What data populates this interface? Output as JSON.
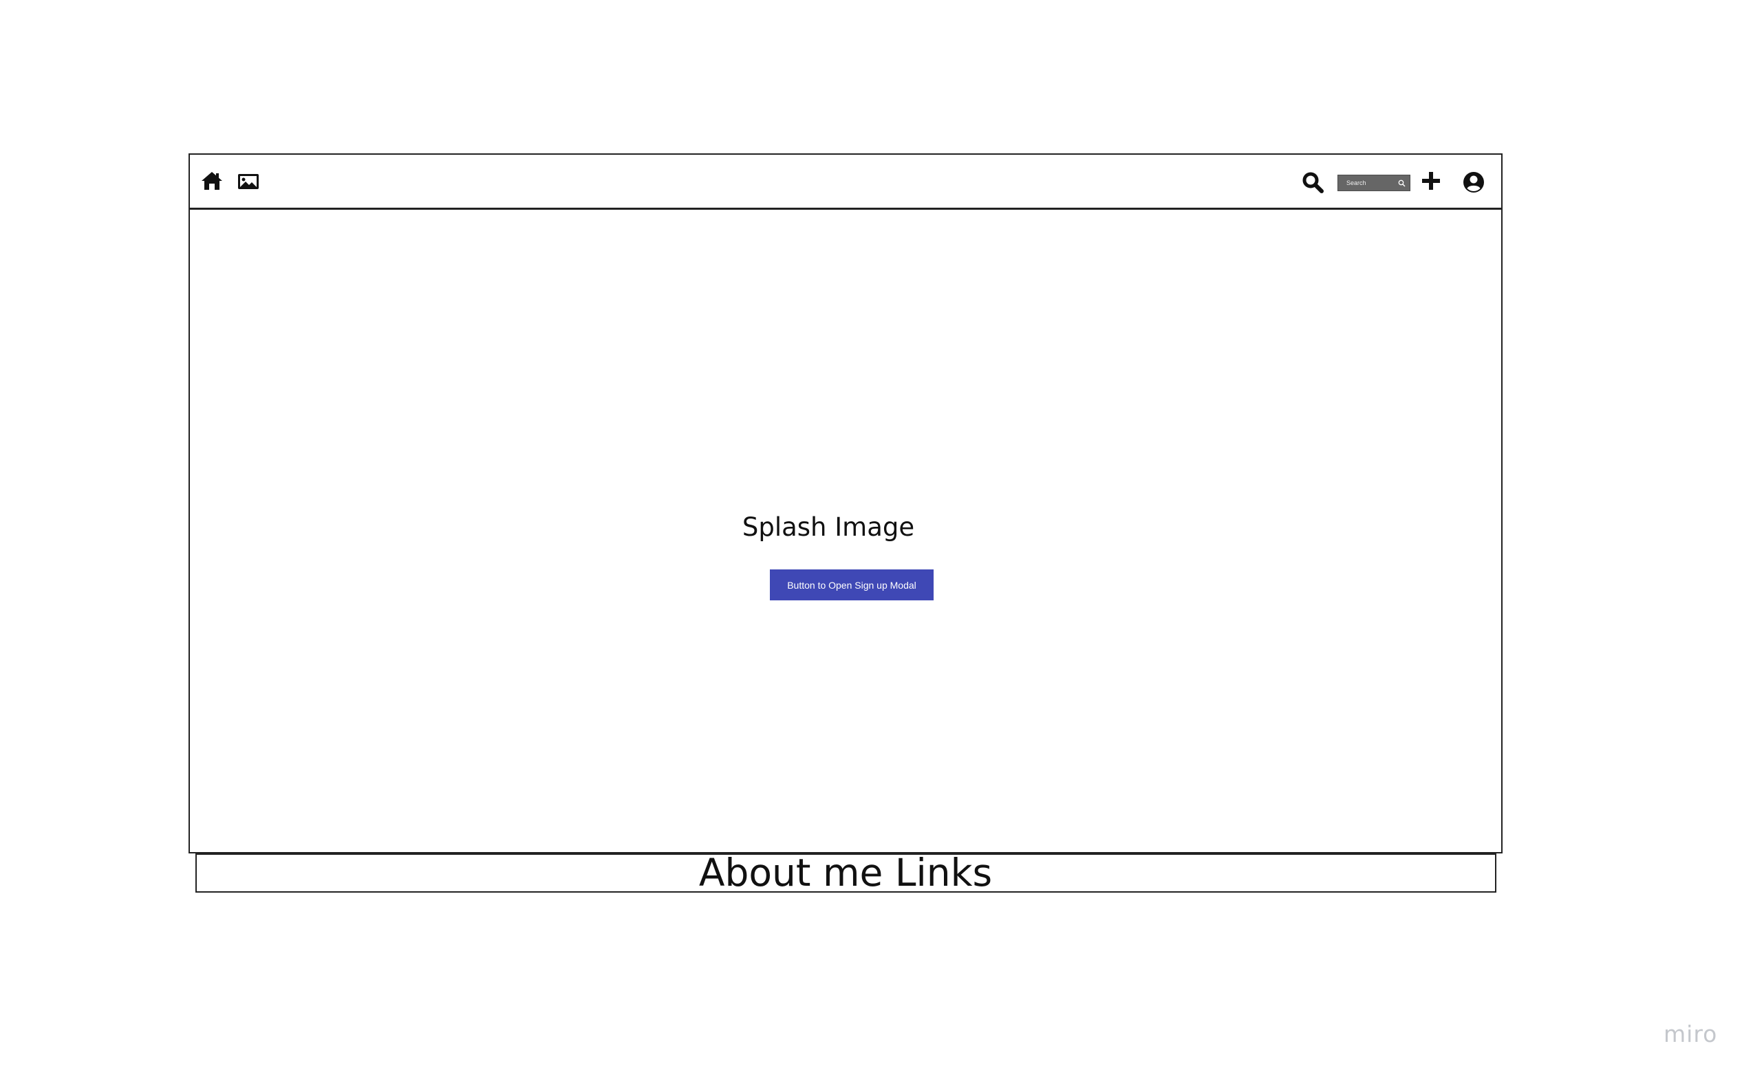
{
  "navbar": {
    "left_icons": [
      "home-icon",
      "image-icon"
    ],
    "right_icons": [
      "search-icon",
      "plus-icon",
      "account-circle-icon"
    ],
    "search": {
      "placeholder": "Search",
      "value": ""
    }
  },
  "main": {
    "splash_title": "Splash Image",
    "signup_button_label": "Button to Open Sign up Modal"
  },
  "footer": {
    "about_title": "About me Links"
  },
  "watermark": {
    "text": "miro"
  },
  "colors": {
    "primary_button": "#3f48b5",
    "search_box": "#666666",
    "border": "#222222",
    "watermark": "#c4c7cc"
  }
}
